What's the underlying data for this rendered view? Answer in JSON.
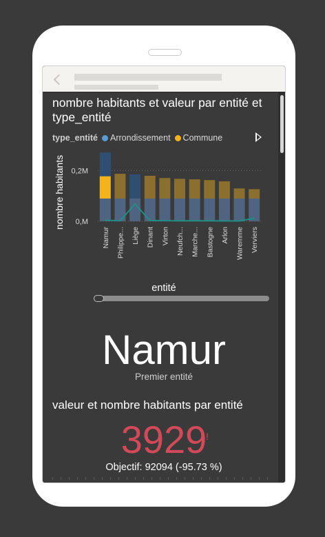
{
  "colors": {
    "background": "#3a3a3a",
    "phone": "#ffffff",
    "arrondissement": "#5b9bd5",
    "commune": "#f2b41a",
    "kpi_bad": "#d24a5a"
  },
  "icons": {
    "back": "chevron-left-icon",
    "legend_next": "play-triangle-icon"
  },
  "visual": {
    "title": "nombre habitants et valeur par entité et type_entité",
    "legend_title": "type_entité",
    "legend_items": [
      {
        "label": "Arrondissement",
        "color": "#5b9bd5"
      },
      {
        "label": "Commune",
        "color": "#f2b41a"
      }
    ]
  },
  "chart_data": {
    "type": "bar",
    "title": "nombre habitants et valeur par entité et type_entité",
    "xlabel": "entité",
    "ylabel": "nombre habitants",
    "ylim": [
      0,
      300000
    ],
    "y_ticks": [
      {
        "value": 0,
        "label": "0,M"
      },
      {
        "value": 200000,
        "label": "0,2M"
      }
    ],
    "categories": [
      "Namur",
      "Philippe...",
      "Liège",
      "Dinant",
      "Virton",
      "Neufch...",
      "Marche...",
      "Bastogne",
      "Arlon",
      "Waremme",
      "Verviers"
    ],
    "series": [
      {
        "name": "Arrondissement",
        "values": [
          272000,
          188000,
          186000,
          180000,
          171000,
          168000,
          166000,
          163000,
          158000,
          130000,
          127000
        ]
      },
      {
        "name": "Commune",
        "values": [
          178000,
          0,
          0,
          0,
          0,
          0,
          0,
          0,
          0,
          0,
          0
        ]
      }
    ],
    "line_values": [
      3929,
      2000,
      68000,
      3000,
      2500,
      2000,
      2000,
      2000,
      1500,
      1500,
      12000
    ],
    "grid": true
  },
  "card": {
    "value": "Namur",
    "label": "Premier entité"
  },
  "kpi": {
    "title": "valeur et nombre habitants par entité",
    "value": "3929",
    "mark": "!",
    "goal": "Objectif: 92094 (-95.73 %)"
  }
}
